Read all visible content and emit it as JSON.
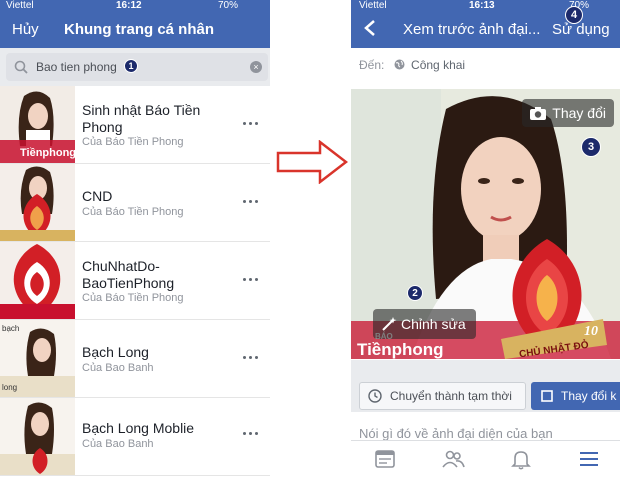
{
  "left": {
    "status": {
      "carrier": "Viettel",
      "time": "16:12",
      "battery": "70%"
    },
    "nav": {
      "cancel": "Hủy",
      "title": "Khung trang cá nhân"
    },
    "search": {
      "value": "Bao tien phong",
      "marker": "1"
    },
    "frames": [
      {
        "title": "Sinh nhật Báo Tiền Phong",
        "owner": "Của Báo Tiền Phong"
      },
      {
        "title": "CND",
        "owner": "Của Báo Tiền Phong"
      },
      {
        "title": "ChuNhatDo-BaoTienPhong",
        "owner": "Của Báo Tiền Phong"
      },
      {
        "title": "Bạch Long",
        "owner": "Của Bao Banh"
      },
      {
        "title": "Bạch Long Moblie",
        "owner": "Của Bao Banh"
      }
    ],
    "thumb_labels": {
      "tienphong": "Tiềnphong",
      "bachlong": "bạch",
      "long": "long"
    }
  },
  "right": {
    "status": {
      "carrier": "Viettel",
      "time": "16:13",
      "battery": "70%"
    },
    "nav": {
      "title": "Xem trước ảnh đại...",
      "use": "Sử dụng",
      "marker": "4"
    },
    "audience": {
      "label": "Đến:",
      "value": "Công khai"
    },
    "photo": {
      "change": "Thay đổi",
      "edit": "Chỉnh sửa",
      "marker_change": "3",
      "marker_edit": "2",
      "frame_caption": "CHỦ NHẬT ĐỎ",
      "frame_number": "10",
      "logo_top": "BÁO",
      "logo": "Tiềnphong"
    },
    "actions": {
      "temporary": "Chuyển thành tạm thời",
      "switch": "Thay đổi k"
    },
    "caption": "Nói gì đó về ảnh đại diện của bạn",
    "tabs": [
      "news-feed-icon",
      "friends-icon",
      "notifications-icon",
      "menu-icon"
    ]
  },
  "colors": {
    "brand": "#4267b2",
    "marker": "#1c2a6b",
    "arrow": "#d9342b",
    "frame_red": "#d21f26",
    "gold": "#d8b360"
  }
}
